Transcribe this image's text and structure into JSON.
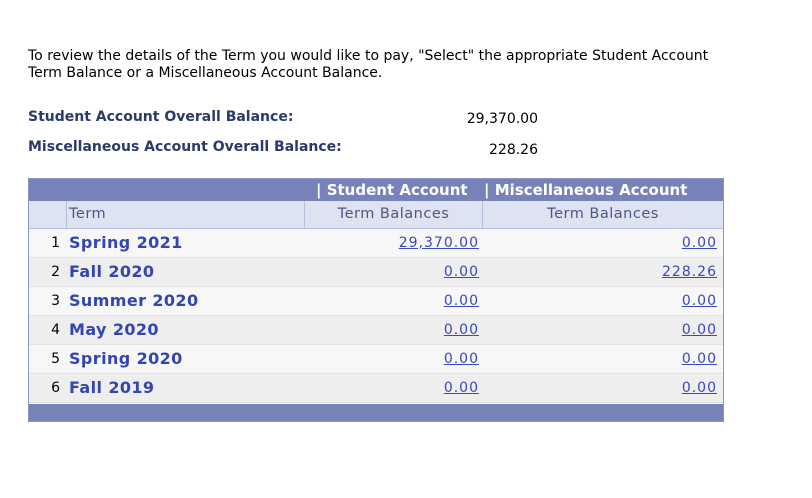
{
  "instructions": "To review the details of the Term you would like to pay, \"Select\" the appropriate Student Account Term Balance or a Miscellaneous Account Balance.",
  "summary": {
    "overall_label": "Student Account Overall Balance:",
    "overall_value": "29,370.00",
    "misc_label": "Miscellaneous Account Overall Balance:",
    "misc_value": "228.26"
  },
  "grid": {
    "group_student": "| Student Account",
    "group_misc": "| Miscellaneous Account",
    "header_term": "Term",
    "header_student": "Term Balances",
    "header_misc": "Term Balances",
    "rows": [
      {
        "num": "1",
        "term": "Spring 2021",
        "student_balance": "29,370.00",
        "misc_balance": "0.00"
      },
      {
        "num": "2",
        "term": "Fall 2020",
        "student_balance": "0.00",
        "misc_balance": "228.26"
      },
      {
        "num": "3",
        "term": "Summer 2020",
        "student_balance": "0.00",
        "misc_balance": "0.00"
      },
      {
        "num": "4",
        "term": "May 2020",
        "student_balance": "0.00",
        "misc_balance": "0.00"
      },
      {
        "num": "5",
        "term": "Spring 2020",
        "student_balance": "0.00",
        "misc_balance": "0.00"
      },
      {
        "num": "6",
        "term": "Fall 2019",
        "student_balance": "0.00",
        "misc_balance": "0.00"
      }
    ]
  },
  "colors": {
    "header_bar": "#7783b8",
    "column_header_bg": "#dde3f0",
    "label_text": "#2a3a6b",
    "link": "#3a4ab8"
  }
}
